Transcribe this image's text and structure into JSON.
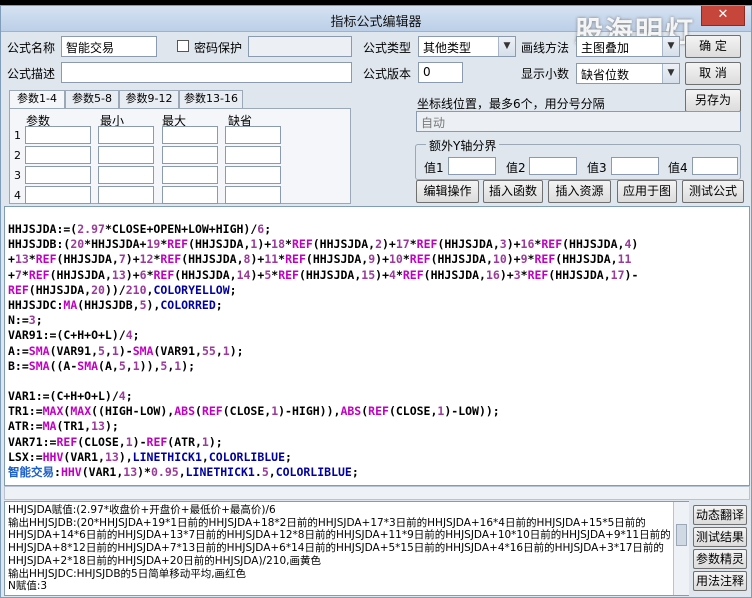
{
  "window": {
    "title": "指标公式编辑器",
    "close_glyph": "✕",
    "watermark": "股海明灯"
  },
  "form": {
    "name_label": "公式名称",
    "name_value": "智能交易",
    "password_label": "密码保护",
    "desc_label": "公式描述",
    "desc_value": "",
    "type_label": "公式类型",
    "type_value": "其他类型",
    "version_label": "公式版本",
    "version_value": "0",
    "draw_label": "画线方法",
    "draw_value": "主图叠加",
    "decimal_label": "显示小数",
    "decimal_value": "缺省位数"
  },
  "buttons": {
    "ok": "确 定",
    "cancel": "取 消",
    "save_as": "另存为",
    "edit_op": "编辑操作",
    "insert_fn": "插入函数",
    "insert_res": "插入资源",
    "apply_chart": "应用于图",
    "test": "测试公式"
  },
  "tabs": [
    "参数1-4",
    "参数5-8",
    "参数9-12",
    "参数13-16"
  ],
  "params": {
    "headers": [
      "参数",
      "最小",
      "最大",
      "缺省"
    ],
    "rows": [
      "1",
      "2",
      "3",
      "4"
    ]
  },
  "coords": {
    "label": "坐标线位置，最多6个，用分号分隔",
    "value": "自动"
  },
  "yaxis": {
    "legend": "额外Y轴分界",
    "labels": [
      "值1",
      "值2",
      "值3",
      "值4"
    ]
  },
  "code_lines": [
    "HHJSJDA:=(2.97*CLOSE+OPEN+LOW+HIGH)/6;",
    "HHJSJDB:(20*HHJSJDA+19*REF(HHJSJDA,1)+18*REF(HHJSJDA,2)+17*REF(HHJSJDA,3)+16*REF(HHJSJDA,4)",
    "+13*REF(HHJSJDA,7)+12*REF(HHJSJDA,8)+11*REF(HHJSJDA,9)+10*REF(HHJSJDA,10)+9*REF(HHJSJDA,11",
    "+7*REF(HHJSJDA,13)+6*REF(HHJSJDA,14)+5*REF(HHJSJDA,15)+4*REF(HHJSJDA,16)+3*REF(HHJSJDA,17)-",
    "REF(HHJSJDA,20))/210,COLORYELLOW;",
    "HHJSJDC:MA(HHJSJDB,5),COLORRED;",
    "N:=3;",
    "VAR91:=(C+H+O+L)/4;",
    "A:=SMA(VAR91,5,1)-SMA(VAR91,55,1);",
    "B:=SMA((A-SMA(A,5,1)),5,1);",
    "",
    "VAR1:=(C+H+O+L)/4;",
    "TR1:=MAX(MAX((HIGH-LOW),ABS(REF(CLOSE,1)-HIGH)),ABS(REF(CLOSE,1)-LOW));",
    "ATR:=MA(TR1,13);",
    "VAR71:=REF(CLOSE,1)-REF(ATR,1);",
    "LSX:=HHV(VAR1,13),LINETHICK1,COLORLIBLUE;",
    "智能交易:HHV(VAR1,13)*0.95,LINETHICK1.5,COLORLIBLUE;"
  ],
  "output_lines": [
    "HHJSJDA赋值:(2.97*收盘价+开盘价+最低价+最高价)/6",
    "输出HHJSJDB:(20*HHJSJDA+19*1日前的HHJSJDA+18*2日前的HHJSJDA+17*3日前的HHJSJDA+16*4日前的HHJSJDA+15*5日前的",
    "HHJSJDA+14*6日前的HHJSJDA+13*7日前的HHJSJDA+12*8日前的HHJSJDA+11*9日前的HHJSJDA+10*10日前的HHJSJDA+9*11日前的",
    "HHJSJDA+8*12日前的HHJSJDA+7*13日前的HHJSJDA+6*14日前的HHJSJDA+5*15日前的HHJSJDA+4*16日前的HHJSJDA+3*17日前的",
    "HHJSJDA+2*18日前的HHJSJDA+20日前的HHJSJDA)/210,画黄色",
    "输出HHJSJDC:HHJSJDB的5日简单移动平均,画红色",
    "N赋值:3"
  ],
  "side_buttons": [
    "动态翻译",
    "测试结果",
    "参数精灵",
    "用法注释"
  ],
  "dropdown_icon": "chevron-down"
}
